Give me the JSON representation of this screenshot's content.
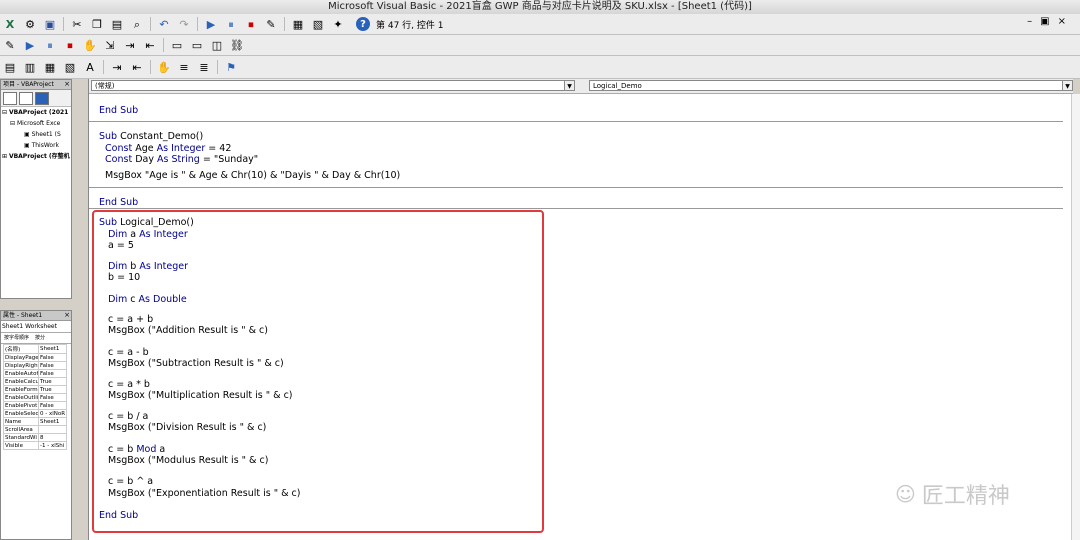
{
  "window": {
    "title": "Microsoft Visual Basic - 2021盲盒 GWP 商品与对应卡片说明及 SKU.xlsx - [Sheet1 (代码)]"
  },
  "toolbar": {
    "status": "第 47 行, 控件 1",
    "help_label": "?"
  },
  "project_pane": {
    "title": "项目 - VBAProject",
    "tree": [
      "VBAProject (2021",
      "Microsoft Exce",
      "Sheet1 (S",
      "ThisWork",
      "VBAProject (存整机"
    ]
  },
  "properties_pane": {
    "title": "属性 - Sheet1",
    "object": "Sheet1 Worksheet",
    "tabs": [
      "按字母顺序",
      "按分"
    ],
    "rows": [
      [
        "(名称)",
        "Sheet1"
      ],
      [
        "DisplayPage",
        "False"
      ],
      [
        "DisplayRight",
        "False"
      ],
      [
        "EnableAutof",
        "False"
      ],
      [
        "EnableCalcu",
        "True"
      ],
      [
        "EnableForm",
        "True"
      ],
      [
        "EnableOutlii",
        "False"
      ],
      [
        "EnablePivot",
        "False"
      ],
      [
        "EnableSelec",
        "0 - xlNoR"
      ],
      [
        "Name",
        "Sheet1"
      ],
      [
        "ScrollArea",
        ""
      ],
      [
        "StandardWi",
        "8"
      ],
      [
        "Visible",
        "-1 - xlShi"
      ]
    ]
  },
  "code_window": {
    "object_combo": "(常规)",
    "proc_combo": "Logical_Demo",
    "lines": [
      "End Sub",
      "Sub Constant_Demo()",
      "  Const Age As Integer = 42",
      "  Const Day As String = \"Sunday\"",
      "  MsgBox \"Age is \" & Age & Chr(10) & \"Dayis \" & Day & Chr(10)",
      "End Sub",
      "Sub Logical_Demo()",
      "   Dim a As Integer",
      "   a = 5",
      "   Dim b As Integer",
      "   b = 10",
      "   Dim c As Double",
      "   c = a + b",
      "   MsgBox (\"Addition Result is \" & c)",
      "   c = a - b",
      "   MsgBox (\"Subtraction Result is \" & c)",
      "   c = a * b",
      "   MsgBox (\"Multiplication Result is \" & c)",
      "   c = b / a",
      "   MsgBox (\"Division Result is \" & c)",
      "   c = b Mod a",
      "   MsgBox (\"Modulus Result is \" & c)",
      "   c = b ^ a",
      "   MsgBox (\"Exponentiation Result is \" & c)",
      "End Sub"
    ]
  },
  "watermark": {
    "text": "匠工精神"
  },
  "colors": {
    "keyword": "#00008b",
    "highlight": "#e0393e"
  }
}
